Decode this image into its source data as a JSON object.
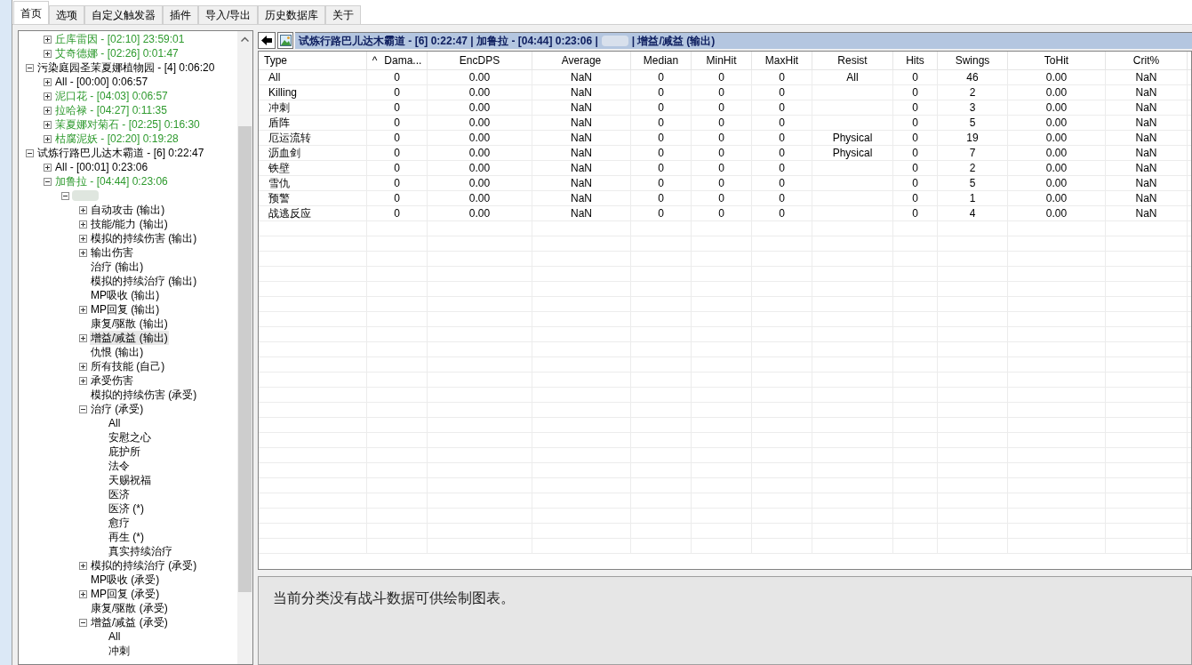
{
  "tabs": [
    {
      "label": "首页",
      "selected": true
    },
    {
      "label": "选项",
      "selected": false
    },
    {
      "label": "自定义触发器",
      "selected": false
    },
    {
      "label": "插件",
      "selected": false
    },
    {
      "label": "导入/导出",
      "selected": false
    },
    {
      "label": "历史数据库",
      "selected": false
    },
    {
      "label": "关于",
      "selected": false
    }
  ],
  "tree": [
    {
      "kind": "offscreen",
      "children": [
        {
          "label": "丘库雷因 - [02:10] 23:59:01",
          "kind": "combatant",
          "expanded": false,
          "selected": false
        },
        {
          "label": "艾奇德娜 - [02:26] 0:01:47",
          "kind": "combatant",
          "expanded": false,
          "selected": false
        }
      ]
    },
    {
      "label": "污染庭园圣茉夏娜植物园 - [4] 0:06:20",
      "expanded": true,
      "selected": false,
      "children": [
        {
          "label": "All - [00:00] 0:06:57",
          "expanded": false,
          "selected": false
        },
        {
          "label": "泥口花 - [04:03] 0:06:57",
          "kind": "combatant",
          "expanded": false,
          "selected": false
        },
        {
          "label": "拉哈禄 - [04:27] 0:11:35",
          "kind": "combatant",
          "expanded": false,
          "selected": false
        },
        {
          "label": "茉夏娜对菊石 - [02:25] 0:16:30",
          "kind": "combatant",
          "expanded": false,
          "selected": false
        },
        {
          "label": "枯腐泥妖 - [02:20] 0:19:28",
          "kind": "combatant",
          "expanded": false,
          "selected": false
        }
      ]
    },
    {
      "label": "试炼行路巴儿达木霸道 - [6] 0:22:47",
      "expanded": true,
      "selected": false,
      "children": [
        {
          "label": "All - [00:01] 0:23:06",
          "expanded": false,
          "selected": false
        },
        {
          "label": "加鲁拉 - [04:44] 0:23:06",
          "kind": "combatant",
          "expanded": true,
          "selected": false,
          "children": [
            {
              "kind": "redacted",
              "expanded": true,
              "selected": false,
              "children": [
                {
                  "label": "自动攻击 (输出)",
                  "expanded": false,
                  "selected": false
                },
                {
                  "label": "技能/能力 (输出)",
                  "expanded": false,
                  "selected": false
                },
                {
                  "label": "模拟的持续伤害 (输出)",
                  "expanded": false,
                  "selected": false
                },
                {
                  "label": "输出伤害",
                  "expanded": false,
                  "selected": false
                },
                {
                  "label": "治疗 (输出)",
                  "selected": false
                },
                {
                  "label": "模拟的持续治疗 (输出)",
                  "selected": false
                },
                {
                  "label": "MP吸收 (输出)",
                  "selected": false
                },
                {
                  "label": "MP回复 (输出)",
                  "expanded": false,
                  "selected": false
                },
                {
                  "label": "康复/驱散 (输出)",
                  "selected": false
                },
                {
                  "label": "增益/减益 (输出)",
                  "expanded": false,
                  "selected": true
                },
                {
                  "label": "仇恨 (输出)",
                  "selected": false
                },
                {
                  "label": "所有技能 (自己)",
                  "expanded": false,
                  "selected": false
                },
                {
                  "label": "承受伤害",
                  "expanded": false,
                  "selected": false
                },
                {
                  "label": "模拟的持续伤害 (承受)",
                  "selected": false
                },
                {
                  "label": "治疗 (承受)",
                  "expanded": true,
                  "selected": false,
                  "children": [
                    {
                      "label": "All",
                      "selected": false
                    },
                    {
                      "label": "安慰之心",
                      "selected": false
                    },
                    {
                      "label": "庇护所",
                      "selected": false
                    },
                    {
                      "label": "法令",
                      "selected": false
                    },
                    {
                      "label": "天赐祝福",
                      "selected": false
                    },
                    {
                      "label": "医济",
                      "selected": false
                    },
                    {
                      "label": "医济 (*)",
                      "selected": false
                    },
                    {
                      "label": "愈疗",
                      "selected": false
                    },
                    {
                      "label": "再生 (*)",
                      "selected": false
                    },
                    {
                      "label": "真实持续治疗",
                      "selected": false
                    }
                  ]
                },
                {
                  "label": "模拟的持续治疗 (承受)",
                  "expanded": false,
                  "selected": false
                },
                {
                  "label": "MP吸收 (承受)",
                  "selected": false
                },
                {
                  "label": "MP回复 (承受)",
                  "expanded": false,
                  "selected": false
                },
                {
                  "label": "康复/驱散 (承受)",
                  "selected": false
                },
                {
                  "label": "增益/减益 (承受)",
                  "expanded": true,
                  "selected": false,
                  "children": [
                    {
                      "label": "All",
                      "selected": false
                    },
                    {
                      "label": "冲刺",
                      "selected": false
                    }
                  ]
                }
              ]
            }
          ]
        }
      ]
    }
  ],
  "header": {
    "title_start": "试炼行路巴儿达木霸道 - [6] 0:22:47 | 加鲁拉 - [04:44] 0:23:06 |",
    "title_end": "| 增益/减益 (输出)"
  },
  "table": {
    "columns": [
      {
        "label": "Type"
      },
      {
        "label": "Dama...",
        "sort": "^"
      },
      {
        "label": "EncDPS"
      },
      {
        "label": "Average"
      },
      {
        "label": "Median"
      },
      {
        "label": "MinHit"
      },
      {
        "label": "MaxHit"
      },
      {
        "label": "Resist"
      },
      {
        "label": "Hits"
      },
      {
        "label": "Swings"
      },
      {
        "label": "ToHit"
      },
      {
        "label": "Crit%"
      }
    ],
    "rows": [
      [
        "All",
        "0",
        "0.00",
        "NaN",
        "0",
        "0",
        "0",
        "All",
        "0",
        "46",
        "0.00",
        "NaN"
      ],
      [
        "Killing",
        "0",
        "0.00",
        "NaN",
        "0",
        "0",
        "0",
        "",
        "0",
        "2",
        "0.00",
        "NaN"
      ],
      [
        "冲刺",
        "0",
        "0.00",
        "NaN",
        "0",
        "0",
        "0",
        "",
        "0",
        "3",
        "0.00",
        "NaN"
      ],
      [
        "盾阵",
        "0",
        "0.00",
        "NaN",
        "0",
        "0",
        "0",
        "",
        "0",
        "5",
        "0.00",
        "NaN"
      ],
      [
        "厄运流转",
        "0",
        "0.00",
        "NaN",
        "0",
        "0",
        "0",
        "Physical",
        "0",
        "19",
        "0.00",
        "NaN"
      ],
      [
        "沥血剑",
        "0",
        "0.00",
        "NaN",
        "0",
        "0",
        "0",
        "Physical",
        "0",
        "7",
        "0.00",
        "NaN"
      ],
      [
        "铁壁",
        "0",
        "0.00",
        "NaN",
        "0",
        "0",
        "0",
        "",
        "0",
        "2",
        "0.00",
        "NaN"
      ],
      [
        "雪仇",
        "0",
        "0.00",
        "NaN",
        "0",
        "0",
        "0",
        "",
        "0",
        "5",
        "0.00",
        "NaN"
      ],
      [
        "预警",
        "0",
        "0.00",
        "NaN",
        "0",
        "0",
        "0",
        "",
        "0",
        "1",
        "0.00",
        "NaN"
      ],
      [
        "战逃反应",
        "0",
        "0.00",
        "NaN",
        "0",
        "0",
        "0",
        "",
        "0",
        "4",
        "0.00",
        "NaN"
      ]
    ]
  },
  "chart_message": "当前分类没有战斗数据可供绘制图表。"
}
